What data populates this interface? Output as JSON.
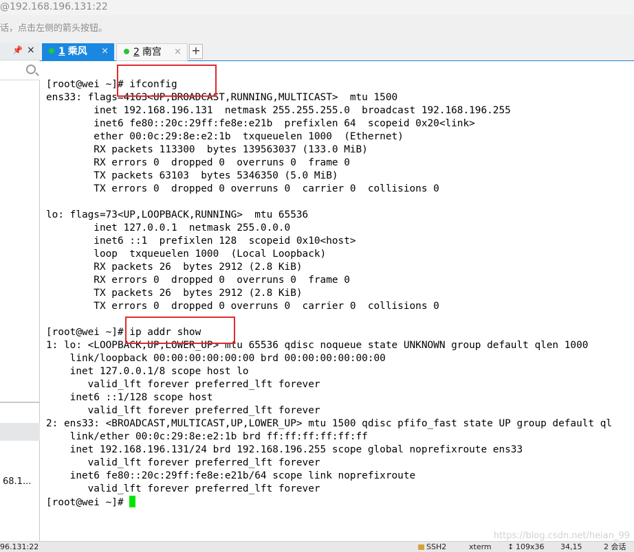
{
  "window": {
    "title": "@192.168.196.131:22",
    "hint": "话，点击左侧的箭头按钮。"
  },
  "sidebar": {
    "pin_glyph": "ᵖ",
    "close_glyph": "×",
    "session_label": "68.1..."
  },
  "tabs": [
    {
      "number": "1",
      "label": "乘风",
      "active": true,
      "close": "×"
    },
    {
      "number": "2",
      "label": "南宫",
      "active": false,
      "close": "×"
    }
  ],
  "new_tab_label": "+",
  "terminal": {
    "lines": [
      "[root@wei ~]# ifconfig",
      "ens33: flags=4163<UP,BROADCAST,RUNNING,MULTICAST>  mtu 1500",
      "        inet 192.168.196.131  netmask 255.255.255.0  broadcast 192.168.196.255",
      "        inet6 fe80::20c:29ff:fe8e:e21b  prefixlen 64  scopeid 0x20<link>",
      "        ether 00:0c:29:8e:e2:1b  txqueuelen 1000  (Ethernet)",
      "        RX packets 113300  bytes 139563037 (133.0 MiB)",
      "        RX errors 0  dropped 0  overruns 0  frame 0",
      "        TX packets 63103  bytes 5346350 (5.0 MiB)",
      "        TX errors 0  dropped 0 overruns 0  carrier 0  collisions 0",
      "",
      "lo: flags=73<UP,LOOPBACK,RUNNING>  mtu 65536",
      "        inet 127.0.0.1  netmask 255.0.0.0",
      "        inet6 ::1  prefixlen 128  scopeid 0x10<host>",
      "        loop  txqueuelen 1000  (Local Loopback)",
      "        RX packets 26  bytes 2912 (2.8 KiB)",
      "        RX errors 0  dropped 0  overruns 0  frame 0",
      "        TX packets 26  bytes 2912 (2.8 KiB)",
      "        TX errors 0  dropped 0 overruns 0  carrier 0  collisions 0",
      "",
      "[root@wei ~]# ip addr show",
      "1: lo: <LOOPBACK,UP,LOWER_UP> mtu 65536 qdisc noqueue state UNKNOWN group default qlen 1000",
      "    link/loopback 00:00:00:00:00:00 brd 00:00:00:00:00:00",
      "    inet 127.0.0.1/8 scope host lo",
      "       valid_lft forever preferred_lft forever",
      "    inet6 ::1/128 scope host",
      "       valid_lft forever preferred_lft forever",
      "2: ens33: <BROADCAST,MULTICAST,UP,LOWER_UP> mtu 1500 qdisc pfifo_fast state UP group default ql",
      "    link/ether 00:0c:29:8e:e2:1b brd ff:ff:ff:ff:ff:ff",
      "    inet 192.168.196.131/24 brd 192.168.196.255 scope global noprefixroute ens33",
      "       valid_lft forever preferred_lft forever",
      "    inet6 fe80::20c:29ff:fe8e:e21b/64 scope link noprefixroute",
      "       valid_lft forever preferred_lft forever"
    ],
    "prompt": "[root@wei ~]# ",
    "watermark": "https://blog.csdn.net/heian_99"
  },
  "statusbar": {
    "address": "96.131:22",
    "protocol": "SSH2",
    "terminal_type": "xterm",
    "size": "109x36",
    "position": "34,15",
    "sessions": "2 会话"
  },
  "colors": {
    "accent": "#1a88e0",
    "connected_dot": "#27c43a",
    "cursor": "#00e600",
    "highlight": "#e0292b"
  }
}
